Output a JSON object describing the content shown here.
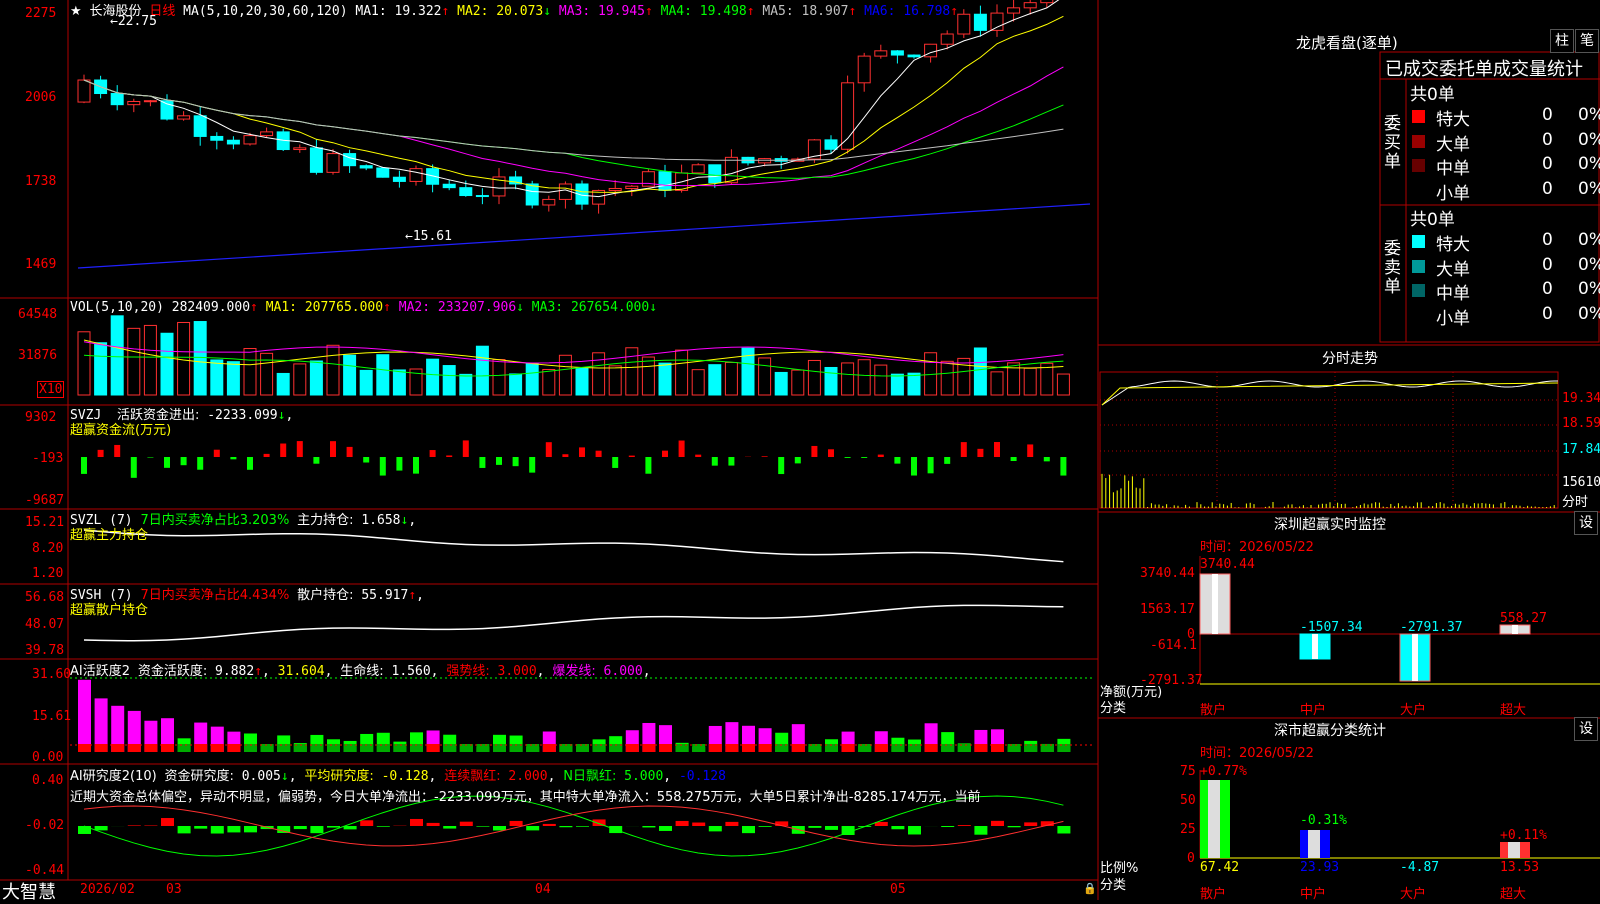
{
  "stock": {
    "star": "★",
    "name": "长海股份",
    "period": "日线"
  },
  "main": {
    "ma_header": "MA(5,10,20,30,60,120)",
    "ma": [
      {
        "label": "MA1:",
        "value": "19.322",
        "arrow": "↑",
        "color": "#ffffff"
      },
      {
        "label": "MA2:",
        "value": "20.073",
        "arrow": "↓",
        "color": "#ffff00"
      },
      {
        "label": "MA3:",
        "value": "19.945",
        "arrow": "↑",
        "color": "#ff00ff"
      },
      {
        "label": "MA4:",
        "value": "19.498",
        "arrow": "↑",
        "color": "#00ff00"
      },
      {
        "label": "MA5:",
        "value": "18.907",
        "arrow": "↑",
        "color": "#c0c0c0"
      },
      {
        "label": "MA6:",
        "value": "16.798",
        "arrow": "↑",
        "color": "#0000ff"
      }
    ],
    "y_labels": [
      "2275",
      "2006",
      "1738",
      "1469"
    ],
    "high_note": "22.75",
    "low_note": "15.61"
  },
  "vol": {
    "header": "VOL(5,10,20)",
    "value": "282409.000",
    "arrow": "↑",
    "ma": [
      {
        "label": "MA1:",
        "value": "207765.000",
        "arrow": "↑",
        "color": "#ffff00"
      },
      {
        "label": "MA2:",
        "value": "233207.906",
        "arrow": "↓",
        "color": "#ff00ff"
      },
      {
        "label": "MA3:",
        "value": "267654.000",
        "arrow": "↓",
        "color": "#00ff00"
      }
    ],
    "y_labels": [
      "64548",
      "31876"
    ],
    "unit": "X10"
  },
  "svzj": {
    "header": "SVZJ",
    "label": "活跃资金进出:",
    "value": "-2233.099",
    "arrow": "↓",
    "sub": "超赢资金流(万元)",
    "y_labels": [
      "9302",
      "-193",
      "-9687"
    ]
  },
  "svzl": {
    "header": "SVZL (7)",
    "label1": "7日内买卖净占比3.203%",
    "label2": "主力持仓:",
    "value": "1.658",
    "arrow": "↓",
    "sub": "超赢主力持仓",
    "y_labels": [
      "15.21",
      "8.20",
      "1.20"
    ]
  },
  "svsh": {
    "header": "SVSH (7)",
    "label1": "7日内买卖净占比4.434%",
    "label2": "散户持仓:",
    "value": "55.917",
    "arrow": "↑",
    "sub": "超赢散户持仓",
    "y_labels": [
      "56.68",
      "48.07",
      "39.78"
    ]
  },
  "ai1": {
    "header": "AI活跃度2",
    "label": "资金活跃度:",
    "value": "9.882",
    "arrow": "↑",
    "v2": "31.604",
    "label3": "生命线:",
    "v3": "1.560",
    "label4": "强势线:",
    "v4": "3.000",
    "label5": "爆发线:",
    "v5": "6.000",
    "y_labels": [
      "31.60",
      "15.61",
      "0.00"
    ]
  },
  "ai2": {
    "header": "AI研究度2(10)",
    "label": "资金研究度:",
    "value": "0.005",
    "arrow": "↓",
    "label2": "平均研究度:",
    "v2": "-0.128",
    "label3": "连续飘红:",
    "v3": "2.000",
    "label4": "N日飘红:",
    "v4": "5.000",
    "v5": "-0.128",
    "text": "近期大资金总体偏空，异动不明显，偏弱势，今日大单净流出：-2233.099万元，其中特大单净流入：558.275万元，大单5日累计净出-8285.174万元，当前",
    "y_labels": [
      "0.40",
      "-0.02",
      "-0.44"
    ]
  },
  "bottom": {
    "brand": "大智慧",
    "date": "2026/02",
    "months": [
      "03",
      "04",
      "05"
    ]
  },
  "dragon": {
    "title": "龙虎看盘(逐单)",
    "btn_pillar": "柱",
    "btn_pen": "笔",
    "tabs_text": "已成交委托单成交量统计",
    "buy": {
      "side": "委买单",
      "total": "共0单",
      "rows": [
        {
          "name": "特大",
          "count": "0",
          "pct": "0%",
          "color": "#ff0000"
        },
        {
          "name": "大单",
          "count": "0",
          "pct": "0%",
          "color": "#990000"
        },
        {
          "name": "中单",
          "count": "0",
          "pct": "0%",
          "color": "#660000"
        },
        {
          "name": "小单",
          "count": "0",
          "pct": "0%",
          "color": "#000000"
        }
      ]
    },
    "sell": {
      "side": "委卖单",
      "total": "共0单",
      "rows": [
        {
          "name": "特大",
          "count": "0",
          "pct": "0%",
          "color": "#00ffff"
        },
        {
          "name": "大单",
          "count": "0",
          "pct": "0%",
          "color": "#009999"
        },
        {
          "name": "中单",
          "count": "0",
          "pct": "0%",
          "color": "#006666"
        },
        {
          "name": "小单",
          "count": "0",
          "pct": "0%",
          "color": "#000000"
        }
      ]
    }
  },
  "intraday": {
    "title": "分时走势",
    "y_labels": [
      "19.34",
      "18.59",
      "17.84"
    ],
    "vol_label": "15610",
    "time_label": "分时"
  },
  "sz_monitor": {
    "title": "深圳超赢实时监控",
    "btn": "设",
    "time": "时间：2026/05/22",
    "y_labels": [
      "3740.44",
      "1563.17",
      "0",
      "-614.1",
      "-2791.37"
    ],
    "unit_label": "净额(万元)",
    "cat_label": "分类",
    "categories": [
      "散户",
      "中户",
      "大户",
      "超大"
    ],
    "values": [
      "3740.44",
      "-1507.34",
      "-2791.37",
      "558.27"
    ]
  },
  "sz_class": {
    "title": "深市超赢分类统计",
    "btn": "设",
    "time": "时间：2026/05/22",
    "y_labels": [
      "75",
      "50",
      "25",
      "0"
    ],
    "unit_label": "比例%",
    "cat_label": "分类",
    "categories": [
      "散户",
      "中户",
      "大户",
      "超大"
    ],
    "top_labels": [
      "+0.77%",
      "-0.31%",
      "",
      "+0.11%"
    ],
    "values": [
      "67.42",
      "23.93",
      "-4.87",
      "13.53"
    ]
  }
}
